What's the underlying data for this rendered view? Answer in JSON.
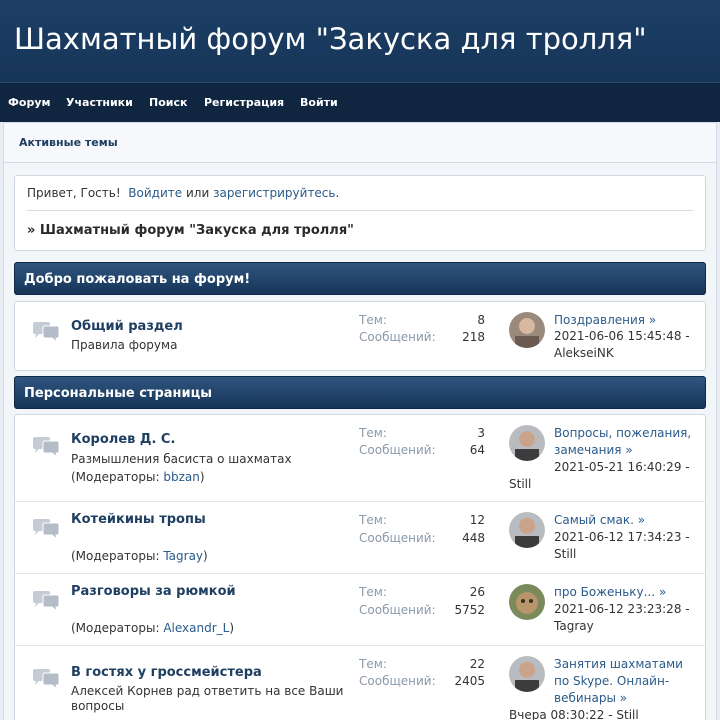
{
  "header": {
    "title": "Шахматный форум \"Закуска для тролля\""
  },
  "nav": [
    "Форум",
    "Участники",
    "Поиск",
    "Регистрация",
    "Войти"
  ],
  "breadcrumb": {
    "active_topics": "Активные темы"
  },
  "welcome": {
    "greeting": "Привет, Гость!",
    "login": "Войдите",
    "or": "или",
    "register": "зарегистрируйтесь",
    "period": ".",
    "forum_link": "» Шахматный форум \"Закуска для тролля\""
  },
  "stat_labels": {
    "topics": "Тем:",
    "posts": "Сообщений:"
  },
  "categories": [
    {
      "title": "Добро пожаловать на форум!",
      "forums": [
        {
          "name": "Общий раздел",
          "desc": "Правила форума",
          "topics": "8",
          "posts": "218",
          "last_title": "Поздравления",
          "arrow": "»",
          "last_date": "2021-06-06 15:45:48",
          "dash": "-",
          "last_user": "AlekseiNK"
        }
      ]
    },
    {
      "title": "Персональные страницы",
      "forums": [
        {
          "name": "Королев Д. С.",
          "desc": "Размышления басиста о шахматах",
          "mods_label": "(Модераторы:",
          "mods_name": "bbzan",
          "mods_close": ")",
          "topics": "3",
          "posts": "64",
          "last_title": "Вопросы, пожелания, замечания",
          "arrow": "»",
          "last_date": "2021-05-21 16:40:29",
          "dash": "-",
          "last_user": "Still"
        },
        {
          "name": "Котейкины тропы",
          "desc": "",
          "mods_label": "(Модераторы:",
          "mods_name": "Tagray",
          "mods_close": ")",
          "topics": "12",
          "posts": "448",
          "last_title": "Самый смак.",
          "arrow": "»",
          "last_date": "2021-06-12 17:34:23",
          "dash": "-",
          "last_user": "Still"
        },
        {
          "name": "Разговоры за рюмкой",
          "desc": "",
          "mods_label": "(Модераторы:",
          "mods_name": "Alexandr_L",
          "mods_close": ")",
          "topics": "26",
          "posts": "5752",
          "last_title": "про Боженьку...",
          "arrow": "»",
          "last_date": "2021-06-12 23:23:28",
          "dash": "-",
          "last_user": "Tagray"
        },
        {
          "name": "В гостях у гроссмейстера",
          "desc": "Алексей Корнев рад ответить на все Ваши вопросы",
          "topics": "22",
          "posts": "2405",
          "last_title": "Занятия шахматами по Skype. Онлайн-вебинары",
          "arrow": "»",
          "last_date": "Вчера 08:30:22",
          "dash": "-",
          "last_user": "Still"
        }
      ]
    }
  ]
}
